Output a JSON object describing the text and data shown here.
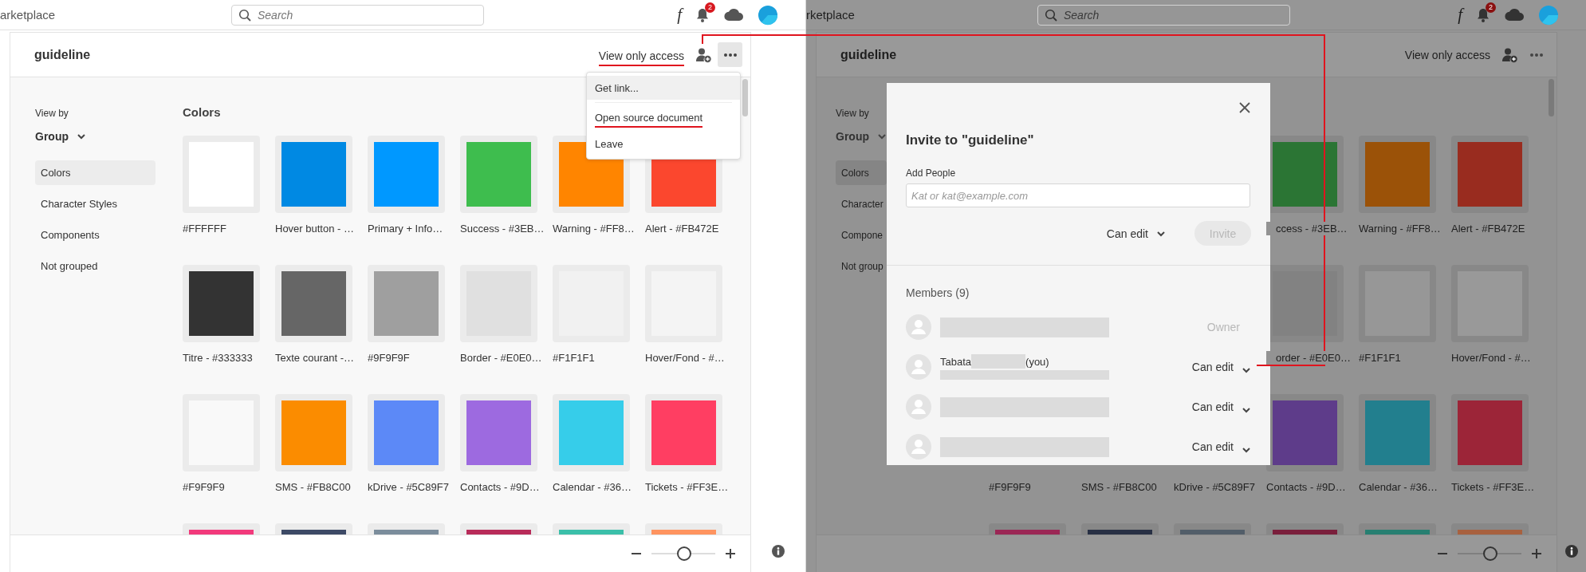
{
  "panels": [
    {
      "dimmed": false,
      "topbar": {
        "partial_title": "arketplace",
        "search": {
          "placeholder": "Search"
        },
        "font_glyph": "f",
        "notification_count": "2"
      },
      "document": {
        "title": "guideline",
        "access": {
          "label": "View only access",
          "underlined": true
        },
        "more_pressed": true,
        "view_by": "View by",
        "group": "Group",
        "groups": [
          {
            "label": "Colors",
            "selected": true
          },
          {
            "label": "Character Styles",
            "selected": false
          },
          {
            "label": "Components",
            "selected": false
          },
          {
            "label": "Not grouped",
            "selected": false
          }
        ],
        "section_title": "Colors",
        "swatch_rows": [
          [
            {
              "kind": "swatch",
              "label": "#FFFFFF",
              "color": "#ffffff"
            },
            {
              "kind": "swatch",
              "label": "Hover button - …",
              "color": "#0089e3"
            },
            {
              "kind": "swatch",
              "label": "Primary + Info…",
              "color": "#0098ff"
            },
            {
              "kind": "swatch",
              "label": "Success - #3EB…",
              "color": "#3ebd4e"
            },
            {
              "kind": "swatch",
              "label": "Warning - #FF8…",
              "color": "#ff8500"
            },
            {
              "kind": "swatch",
              "label": "Alert - #FB472E",
              "color": "#fb472e"
            }
          ],
          [
            {
              "kind": "swatch",
              "label": "Titre - #333333",
              "color": "#333333"
            },
            {
              "kind": "swatch",
              "label": "Texte courant -…",
              "color": "#666666"
            },
            {
              "kind": "swatch",
              "label": "#9F9F9F",
              "color": "#9f9f9f"
            },
            {
              "kind": "swatch",
              "label": "Border - #E0E0…",
              "color": "#e0e0e0"
            },
            {
              "kind": "swatch",
              "label": "#F1F1F1",
              "color": "#f1f1f1"
            },
            {
              "kind": "swatch",
              "label": "Hover/Fond - #…",
              "color": "#f4f4f4"
            }
          ],
          [
            {
              "kind": "swatch",
              "label": "#F9F9F9",
              "color": "#f9f9f9"
            },
            {
              "kind": "swatch",
              "label": "SMS - #FB8C00",
              "color": "#fb8c00"
            },
            {
              "kind": "swatch",
              "label": "kDrive - #5C89F7",
              "color": "#5c89f7"
            },
            {
              "kind": "swatch",
              "label": "Contacts - #9D…",
              "color": "#9d6ae0"
            },
            {
              "kind": "swatch",
              "label": "Calendar - #36…",
              "color": "#36cdea"
            },
            {
              "kind": "swatch",
              "label": "Tickets - #FF3E…",
              "color": "#ff3e62"
            }
          ],
          [
            {
              "kind": "swatch",
              "color": "#f23a7c"
            },
            {
              "kind": "swatch",
              "color": "#3d4a66"
            },
            {
              "kind": "swatch",
              "color": "#7b8d9c"
            },
            {
              "kind": "swatch",
              "color": "#b82c5a"
            },
            {
              "kind": "swatch",
              "color": "#3bbfa9"
            },
            {
              "kind": "swatch",
              "color": "#ff9460"
            }
          ]
        ]
      },
      "menu": {
        "items": [
          {
            "label": "Get link...",
            "highlighted": true,
            "underlined": false
          },
          {
            "label": "Open source document",
            "highlighted": false,
            "underlined": true
          },
          {
            "label": "Leave",
            "highlighted": false,
            "underlined": false
          }
        ]
      },
      "zoom": {
        "level": 0.5
      }
    },
    {
      "dimmed": true,
      "topbar": {
        "partial_title": "rketplace",
        "search": {
          "placeholder": "Search"
        },
        "font_glyph": "f",
        "notification_count": "2"
      },
      "document": {
        "title": "guideline",
        "access": {
          "label": "View only access",
          "underlined": false
        },
        "more_pressed": false,
        "view_by": "View by",
        "group": "Group",
        "groups": [
          {
            "label": "Colors",
            "selected": true
          },
          {
            "label": "Character",
            "selected": false
          },
          {
            "label": "Compone",
            "selected": false
          },
          {
            "label": "Not group",
            "selected": false
          }
        ],
        "swatch_rows": [
          [
            {
              "kind": "covered"
            },
            {
              "kind": "covered"
            },
            {
              "kind": "covered"
            },
            {
              "kind": "partial",
              "label": "ccess - #3EB…",
              "color": "#2b7534"
            },
            {
              "kind": "swatch",
              "label": "Warning - #FF8…",
              "color": "#9b5208"
            },
            {
              "kind": "swatch",
              "label": "Alert - #FB472E",
              "color": "#992c1f"
            }
          ],
          [
            {
              "kind": "covered"
            },
            {
              "kind": "covered"
            },
            {
              "kind": "covered"
            },
            {
              "kind": "partial",
              "label": "order - #E0E0…",
              "color": "#828282"
            },
            {
              "kind": "swatch",
              "label": "#F1F1F1",
              "color": "#979797"
            },
            {
              "kind": "swatch",
              "label": "Hover/Fond - #…",
              "color": "#999999"
            }
          ],
          [
            {
              "kind": "covered",
              "label": "#F9F9F9"
            },
            {
              "kind": "covered",
              "label": "SMS - #FB8C00"
            },
            {
              "kind": "covered",
              "label": "kDrive - #5C89F7"
            },
            {
              "kind": "swatch",
              "label": "Contacts - #9D…",
              "color": "#5e3c8a"
            },
            {
              "kind": "swatch",
              "label": "Calendar - #36…",
              "color": "#227f8e"
            },
            {
              "kind": "swatch",
              "label": "Tickets - #FF3E…",
              "color": "#9c2538"
            }
          ],
          [
            {
              "kind": "swatch",
              "color": "#9b2755"
            },
            {
              "kind": "swatch",
              "color": "#283044"
            },
            {
              "kind": "swatch",
              "color": "#525e69"
            },
            {
              "kind": "swatch",
              "color": "#7a1f3c"
            },
            {
              "kind": "swatch",
              "color": "#277f71"
            },
            {
              "kind": "swatch",
              "color": "#a8613f"
            }
          ]
        ]
      },
      "dialog": {
        "title": "Invite to \"guideline\"",
        "field_label": "Add People",
        "field": {
          "placeholder": "Kat or kat@example.com"
        },
        "permission": "Can edit",
        "invite": {
          "label": "Invite",
          "disabled": true
        },
        "members_title": "Members (9)",
        "members": [
          {
            "kind": "owner",
            "role": "Owner"
          },
          {
            "kind": "select",
            "name": "Tabata",
            "suffix": "(you)",
            "role": "Can edit"
          },
          {
            "kind": "select",
            "role": "Can edit"
          },
          {
            "kind": "select",
            "role": "Can edit"
          }
        ]
      },
      "zoom": {
        "level": 0.5
      }
    }
  ]
}
